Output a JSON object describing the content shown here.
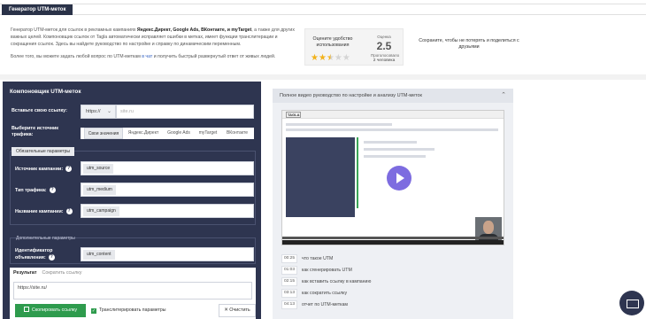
{
  "header": {
    "title": "Генератор UTM-меток"
  },
  "intro": {
    "p1_a": "Генератор UTM-меток для ссылок в рекламных кампаниях ",
    "p1_b": "Яндекс.Директ, Google Ads, ВКонтакте, и myTarget",
    "p1_c": ", а также для других важных целей. Компоновщик ссылок от Tagla автоматически исправляет ошибки в метках, имеет функции транслитерации и сокращения ссылок. Здесь вы найдете руководство по настройке и справку по динамическим переменным.",
    "p2_a": "Более того, вы можете задать любой вопрос по UTM-меткам ",
    "p2_link": "в чат",
    "p2_b": " и получить быстрый развернутый ответ от живых людей."
  },
  "rating": {
    "label": "Оцените удобство использования",
    "score_caption": "Оценка",
    "score": "2.5",
    "votes_caption": "Проголосовало",
    "votes": "2 человека",
    "stars_filled": 2.5,
    "stars_total": 5
  },
  "share": {
    "text": "Сохраните, чтобы не потерять и поделиться с друзьями"
  },
  "builder": {
    "title": "Компоновщик UTM-меток",
    "link_label": "Вставьте свою ссылку:",
    "protocol": "https://",
    "url_placeholder": "site.ru",
    "source_label": "Выберите источник трафика:",
    "source_tabs": [
      "Свои значения",
      "Яндекс.Директ",
      "Google Ads",
      "myTarget",
      "ВКонтакте"
    ],
    "required_group": "Обязательные параметры",
    "params": [
      {
        "label": "Источник кампании:",
        "tag": "utm_source"
      },
      {
        "label": "Тип трафика:",
        "tag": "utm_medium"
      },
      {
        "label": "Название кампании:",
        "tag": "utm_campaign"
      }
    ],
    "optional_group": "Дополнительные параметры",
    "optional_params": [
      {
        "label": "Идентификатор объявления:",
        "tag": "utm_content"
      }
    ],
    "result_tab": "Результат",
    "shorten_tab": "Сократить ссылку",
    "result_value": "https://site.ru/",
    "copy_label": "Скопировать ссылку",
    "translit_label": "Транслитерировать параметры",
    "clear_label": "Очистить"
  },
  "video": {
    "header": "Полное видео руководство по настройке и анализу UTM-меток",
    "logo": "TAGLA",
    "chapters": [
      {
        "time": "00:25",
        "title": "что такое UTM"
      },
      {
        "time": "01:03",
        "title": "как сгенерировать UTM"
      },
      {
        "time": "02:15",
        "title": "как вставить ссылку в кампанию"
      },
      {
        "time": "03:13",
        "title": "как сократить ссылку"
      },
      {
        "time": "04:13",
        "title": "отчет по UTM-меткам"
      }
    ]
  },
  "colors": {
    "panel": "#2e3550",
    "accent_green": "#2e9b4d",
    "star": "#f2b21b",
    "play": "#7d6ce0"
  }
}
